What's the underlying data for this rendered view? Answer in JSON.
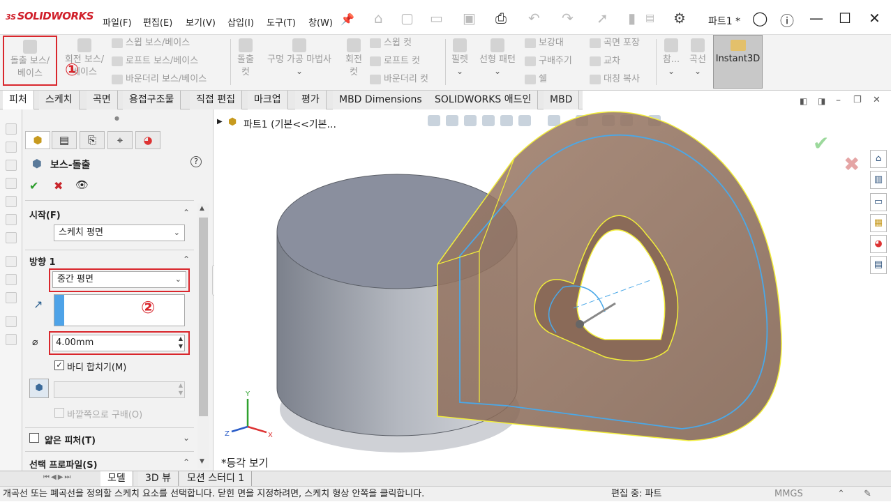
{
  "app": {
    "logo": "SOLIDWORKS",
    "logo_mark": "3S",
    "title": "파트1 *"
  },
  "menu": [
    "파일(F)",
    "편집(E)",
    "보기(V)",
    "삽입(I)",
    "도구(T)",
    "창(W)"
  ],
  "commands": {
    "extrude_boss": "돌출 보스/\n베이스",
    "revolve_boss": "회전 보스/\n베이스",
    "sweep_boss": "스윕 보스/베이스",
    "loft_boss": "로프트 보스/베이스",
    "boundary_boss": "바운더리 보스/베이스",
    "extrude_cut": "돌출\n컷",
    "hole_wizard": "구멍 가공 마법사",
    "revolve_cut": "회전\n컷",
    "swept_cut": "스윕 컷",
    "lofted_cut": "로프트 컷",
    "boundary_cut": "바운더리 컷",
    "fillet": "필렛",
    "linear_pattern": "선형 패턴",
    "rib": "보강대",
    "draft": "구배주기",
    "shell": "쉘",
    "wrap": "곡면 포장",
    "intersect": "교차",
    "mirror": "대칭 복사",
    "reference": "참...",
    "curves": "곡선",
    "instant3d": "Instant3D",
    "step1_marker": "①",
    "step2_marker": "②"
  },
  "tabs": [
    "피처",
    "스케치",
    "곡면",
    "용접구조물",
    "직접 편집",
    "마크업",
    "평가",
    "MBD Dimensions",
    "SOLIDWORKS 애드인",
    "MBD"
  ],
  "property_manager": {
    "title": "보스-돌출",
    "ok": "✔",
    "cancel": "✖",
    "preview": "👁",
    "help": "?",
    "from_label": "시작(F)",
    "from_value": "스케치 평면",
    "dir1_label": "방향 1",
    "end_condition": "중간 평면",
    "depth": "4.00mm",
    "merge_result": "바디 합치기(M)",
    "draft_outward": "바깥쪽으로 구배(O)",
    "thin_feature": "얇은 피처(T)",
    "selected_contours": "선택 프로파일(S)"
  },
  "viewport": {
    "tree_label": "파트1  (기본<<기본...",
    "view_label": "*등각 보기",
    "triad": {
      "x": "X",
      "y": "Y",
      "z": "Z"
    }
  },
  "bottom_tabs": [
    "모델",
    "3D 뷰",
    "모션 스터디 1"
  ],
  "status": {
    "message": "개곡선 또는 폐곡선을 정의할 스케치 요소를 선택합니다. 닫힌 면을 지정하려면, 스케치 형상 안쪽을 클릭합니다.",
    "editing": "편집 중: 파트",
    "units": "MMGS"
  },
  "colors": {
    "accent_red": "#d9262c",
    "part_gray": "#8f949c",
    "part_brown": "#8a6a58",
    "edge_yellow": "#f2ee3a",
    "edge_blue": "#4aa8e8"
  }
}
